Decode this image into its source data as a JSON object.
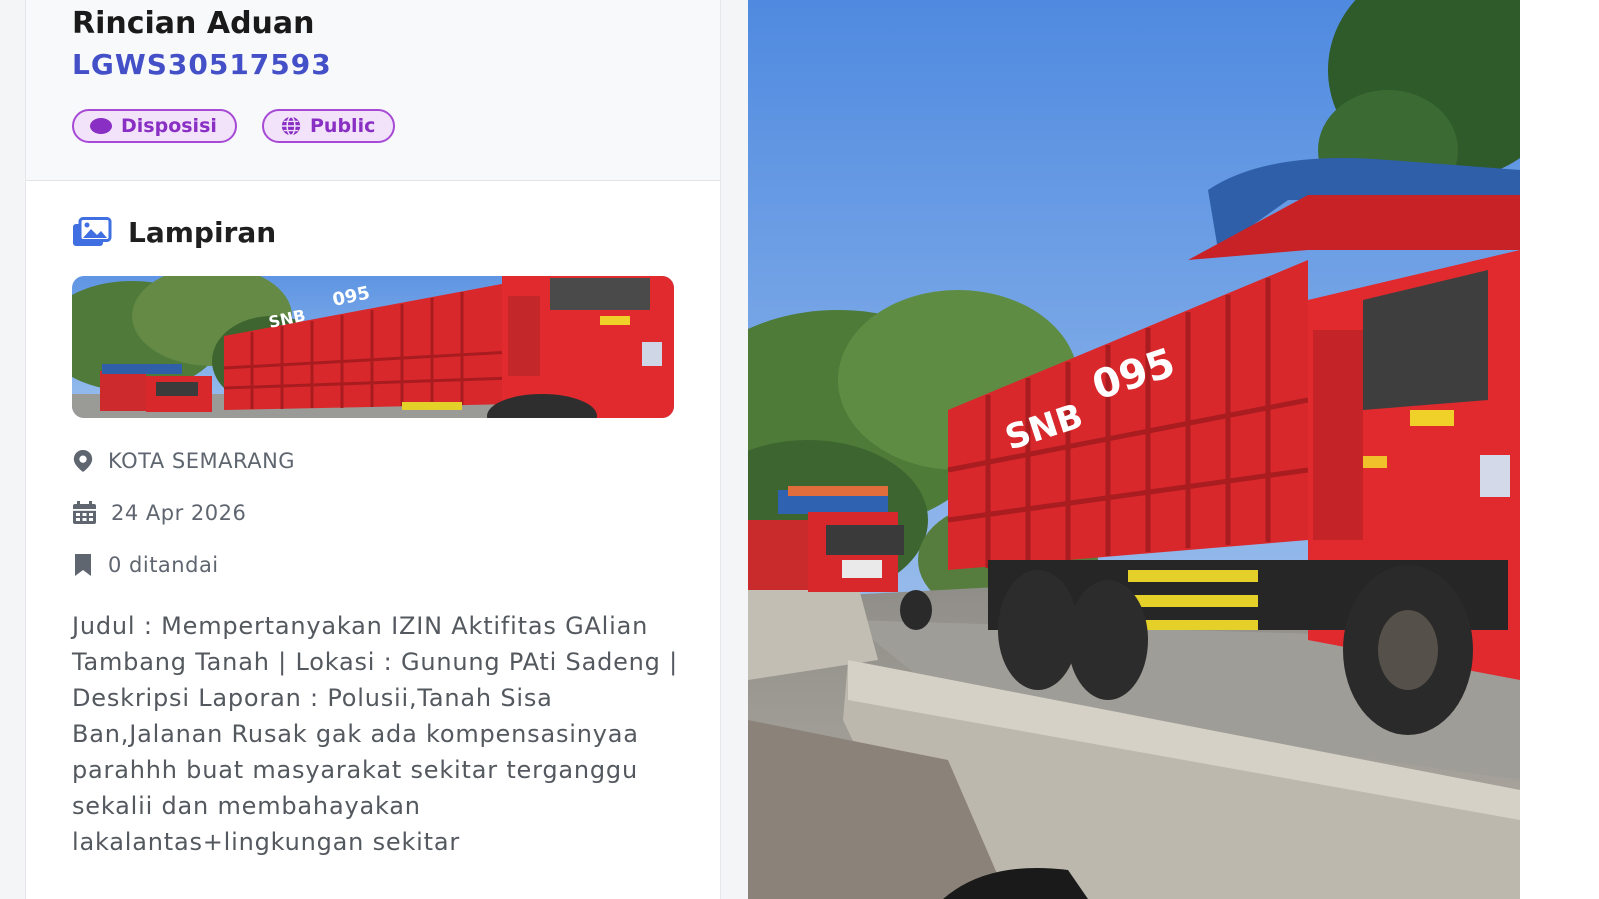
{
  "header": {
    "title": "Rincian Aduan",
    "code": "LGWS30517593",
    "badges": {
      "status": "Disposisi",
      "visibility": "Public"
    }
  },
  "attachments": {
    "title": "Lampiran",
    "truck_labels": [
      "SNB",
      "095"
    ]
  },
  "meta": {
    "location": "KOTA SEMARANG",
    "date": "24 Apr 2026",
    "bookmarks": "0 ditandai"
  },
  "description": "Judul : Mempertanyakan IZIN Aktifitas GAlian Tambang Tanah | Lokasi : Gunung PAti Sadeng | Deskripsi Laporan : Polusii,Tanah Sisa Ban,Jalanan Rusak gak ada kompensasinyaa parahhh buat masyarakat sekitar terganggu sekalii dan membahayakan lakalantas+lingkungan sekitar",
  "colors": {
    "accent": "#4450c8",
    "badge": "#8a2fc4",
    "truck": "#d9282c"
  },
  "icons": [
    "image-gallery-icon",
    "map-pin-icon",
    "calendar-icon",
    "bookmark-icon",
    "globe-icon"
  ]
}
